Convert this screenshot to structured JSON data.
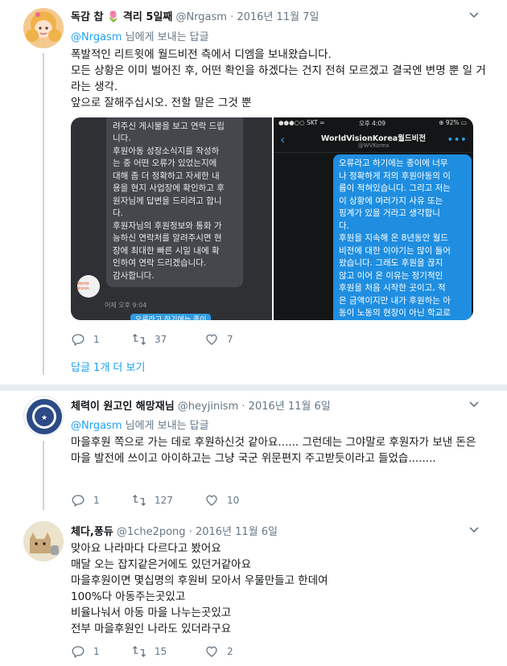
{
  "tweets": [
    {
      "name": "독감 찹",
      "name_suffix": "격리 5일째",
      "handle": "@Nrgasm",
      "date": "2016년 11월 7일",
      "reply_mention": "@Nrgasm",
      "reply_text": " 님에게 보내는 답글",
      "body": "폭발적인 리트윗에 월드비전 측에서 디엠을 보내왔습니다.\n모든 상황은 이미 벌어진 후, 어떤 확인을 하겠다는 건지 전혀 모르겠고 결국엔 변명 뿐 일 거라는 생각.\n앞으로 잘해주십시오. 전할 말은 그것 뿐",
      "replies": "1",
      "retweets": "37",
      "likes": "7",
      "show_more": "답글 1개 더 보기"
    },
    {
      "name": "체력이 원고인 해망재님",
      "handle": "@heyjinism",
      "date": "2016년 11월 6일",
      "reply_mention": "@Nrgasm",
      "reply_text": " 님에게 보내는 답글",
      "body": "마을후원 쪽으로 가는 데로 후원하신것 같아요...... 그런데는 그야말로 후원자가 보낸 돈은 마을 발전에 쓰이고 아이하고는 그냥 국군 위문편지 주고받듯이라고 들었습........",
      "replies": "1",
      "retweets": "127",
      "likes": "10"
    },
    {
      "name": "체다,퐁듀",
      "handle": "@1che2pong",
      "date": "2016년 11월 6일",
      "body": "맞아요 나라마다 다르다고 봤어요\n매달 오는 잡지같은거에도 있던거같아요\n마을후원이면 몇십명의 후원비 모아서 우물만들고 한데여\n100%다 아동주는곳있고\n비율나눠서 아동 마을 나누는곳있고\n전부 마을후원인 나라도 있더라구요",
      "replies": "1",
      "retweets": "15",
      "likes": "2"
    }
  ],
  "media": {
    "left_chat": "후원자님께서 지난 11월 6일 올\n려주신 게시물을 보고 연락 드립\n니다.\n후원아동 성장소식지를 작성하\n는 중 어떤 오류가 있었는지에\n대해 좀 더 정확하고 자세한 내\n용을 현지 사업장에 확인하고 후\n원자님께 답변을 드리려고 합니\n다.\n후원자님의 후원정보와 통화 가\n능하신 연락처를 알려주시면 현\n장에 최대한 빠른 시일 내에 확\n인하여 연락 드리겠습니다.\n감사합니다.",
    "left_time": "어제 오후 9:04",
    "left_bottom": "오류라고 하기에는 종이에 너무",
    "right_status_left": "●●●○○ SKT ≈",
    "right_status_center": "오후 4:09",
    "right_status_right": "⊕ 92% ▭",
    "right_title": "WorldVisionKorea월드비전",
    "right_subtitle": "@WVKorea",
    "right_chat": "오류라고 하기에는 종이에 너무\n나 정확하게 저의 후원아동의 이\n름이 적혀있습니다. 그리고 저는\n이 상황에 여러가지 사유 또는\n핑계가 있을 거라고 생각합니\n다.\n후원을 지속해 온 8년동안 월드\n비전에 대한 이야기는 많이 들어\n왔습니다. 그래도 후원을 끊지\n않고 이어 온 이유는 정기적인\n후원을 처음 시작한 곳이고, 적\n은 금액이지만 내가 후원하는 아\n동이 노동의 현장이 아닌 학교로",
    "logo_text": "World Vision"
  },
  "icons": {
    "reply": "reply-icon",
    "retweet": "retweet-icon",
    "like": "heart-icon",
    "caret": "chevron-down-icon",
    "flower": "tulip-emoji-icon"
  },
  "colors": {
    "link": "#1da1f2",
    "muted": "#657786",
    "divider": "#e6ecf0"
  }
}
